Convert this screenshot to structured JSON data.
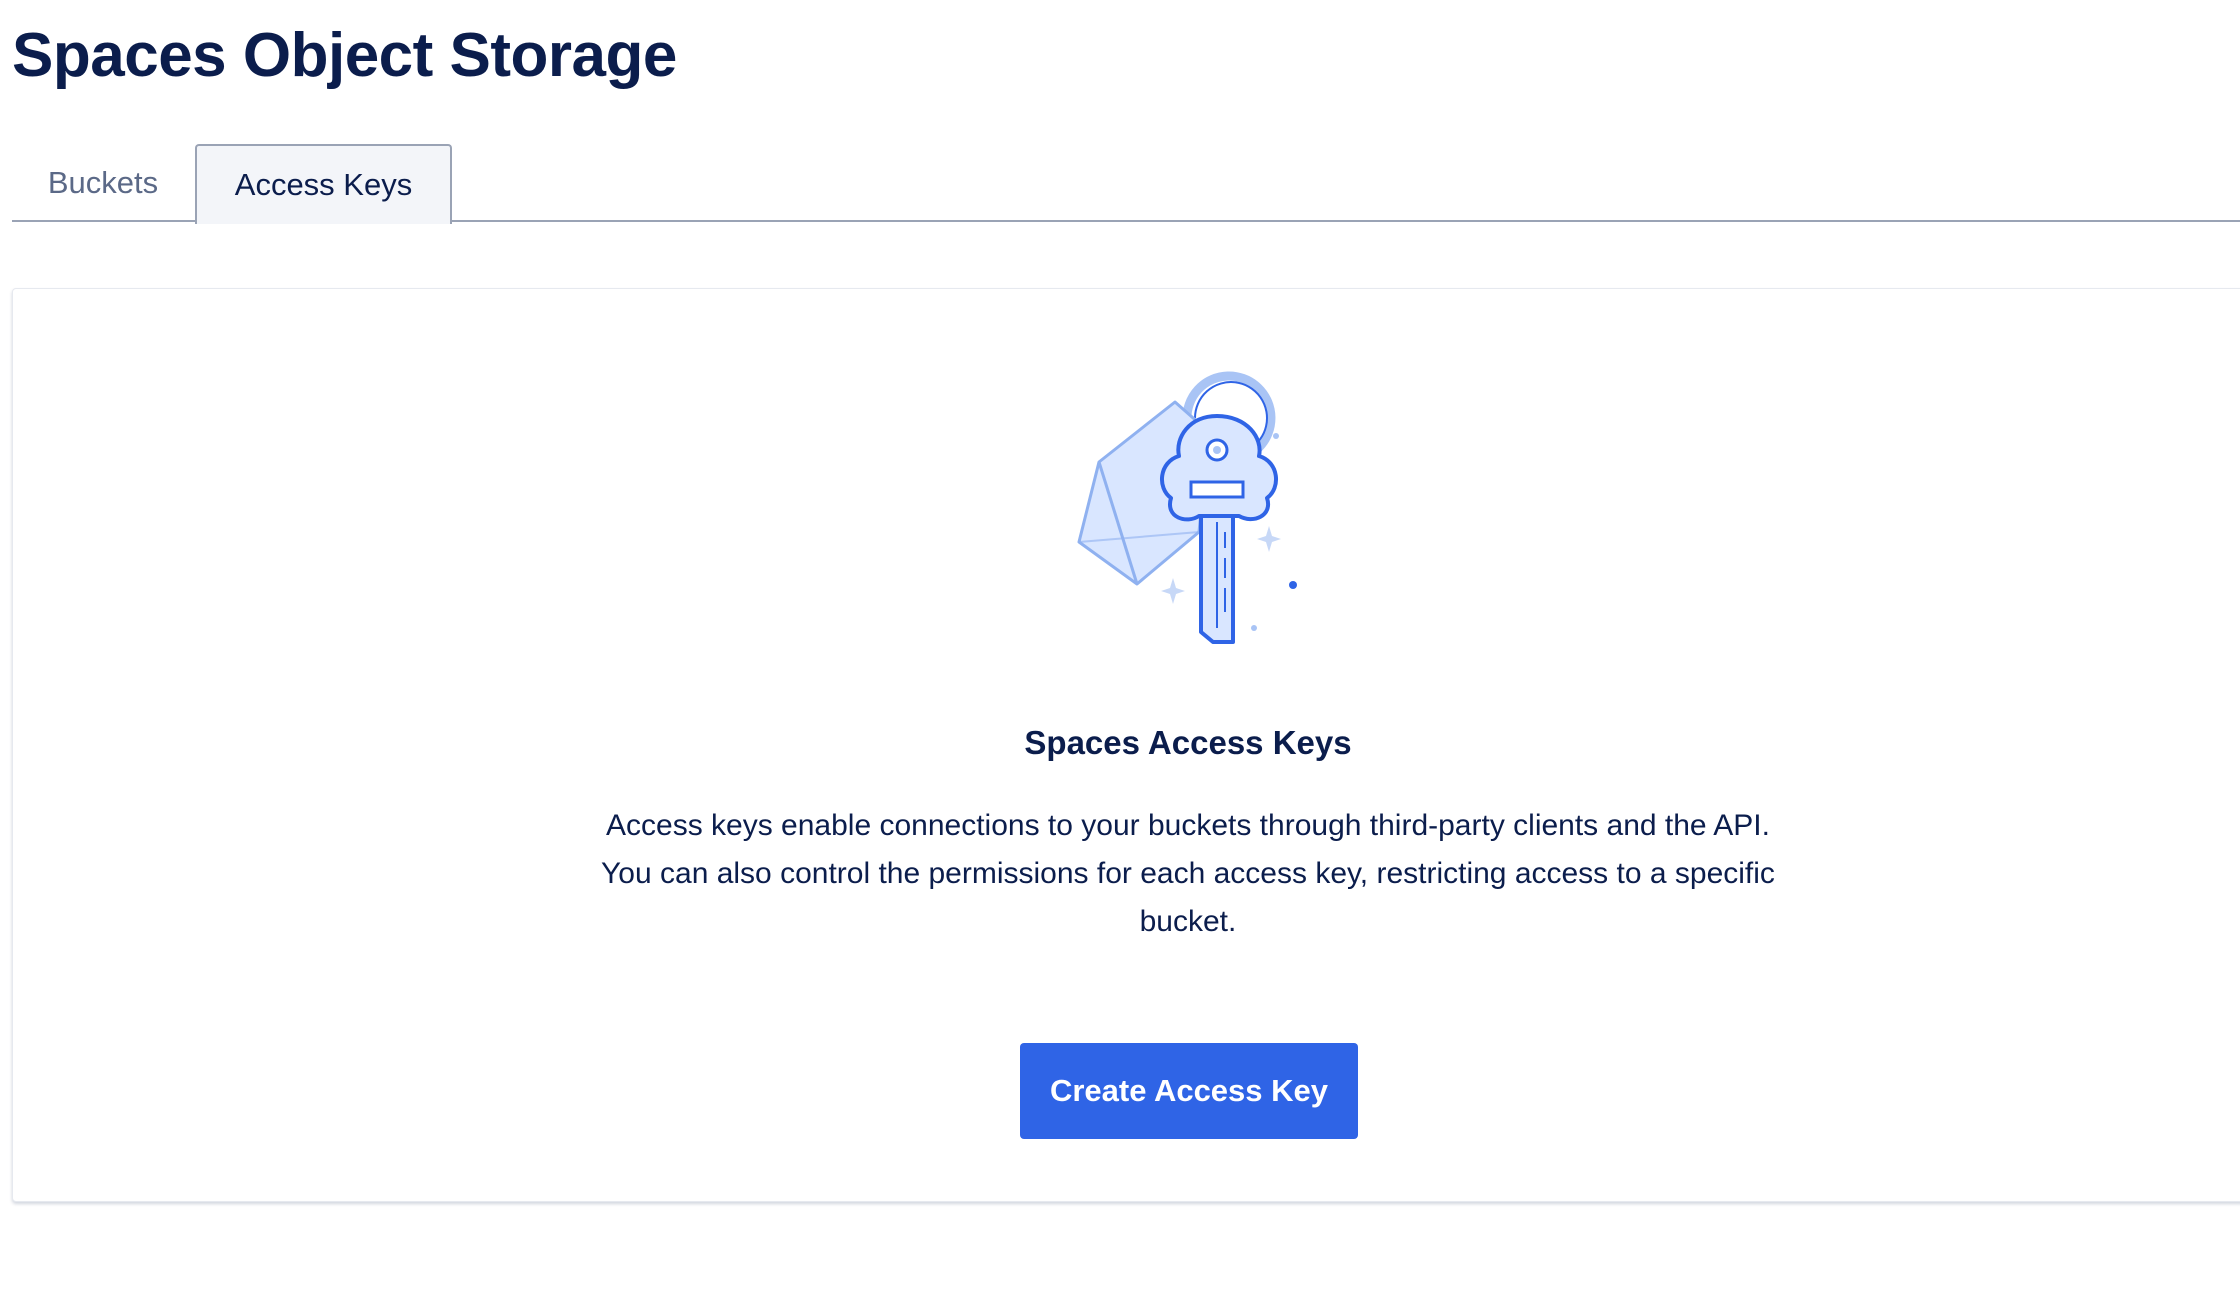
{
  "page": {
    "title": "Spaces Object Storage"
  },
  "tabs": [
    {
      "label": "Buckets",
      "active": false
    },
    {
      "label": "Access Keys",
      "active": true
    }
  ],
  "empty_state": {
    "icon": "key-with-tag-icon",
    "title": "Spaces Access Keys",
    "description": "Access keys enable connections to your buckets through third-party clients and the API. You can also control the permissions for each access key, restricting access to a specific bucket.",
    "button_label": "Create Access Key"
  },
  "colors": {
    "primary_button": "#2f64e6",
    "heading": "#0b1d4c",
    "inactive_tab": "#5b6987",
    "active_tab_bg": "#f3f5f9",
    "illustration_stroke": "#2f64e6",
    "illustration_fill": "#d9e6ff"
  }
}
